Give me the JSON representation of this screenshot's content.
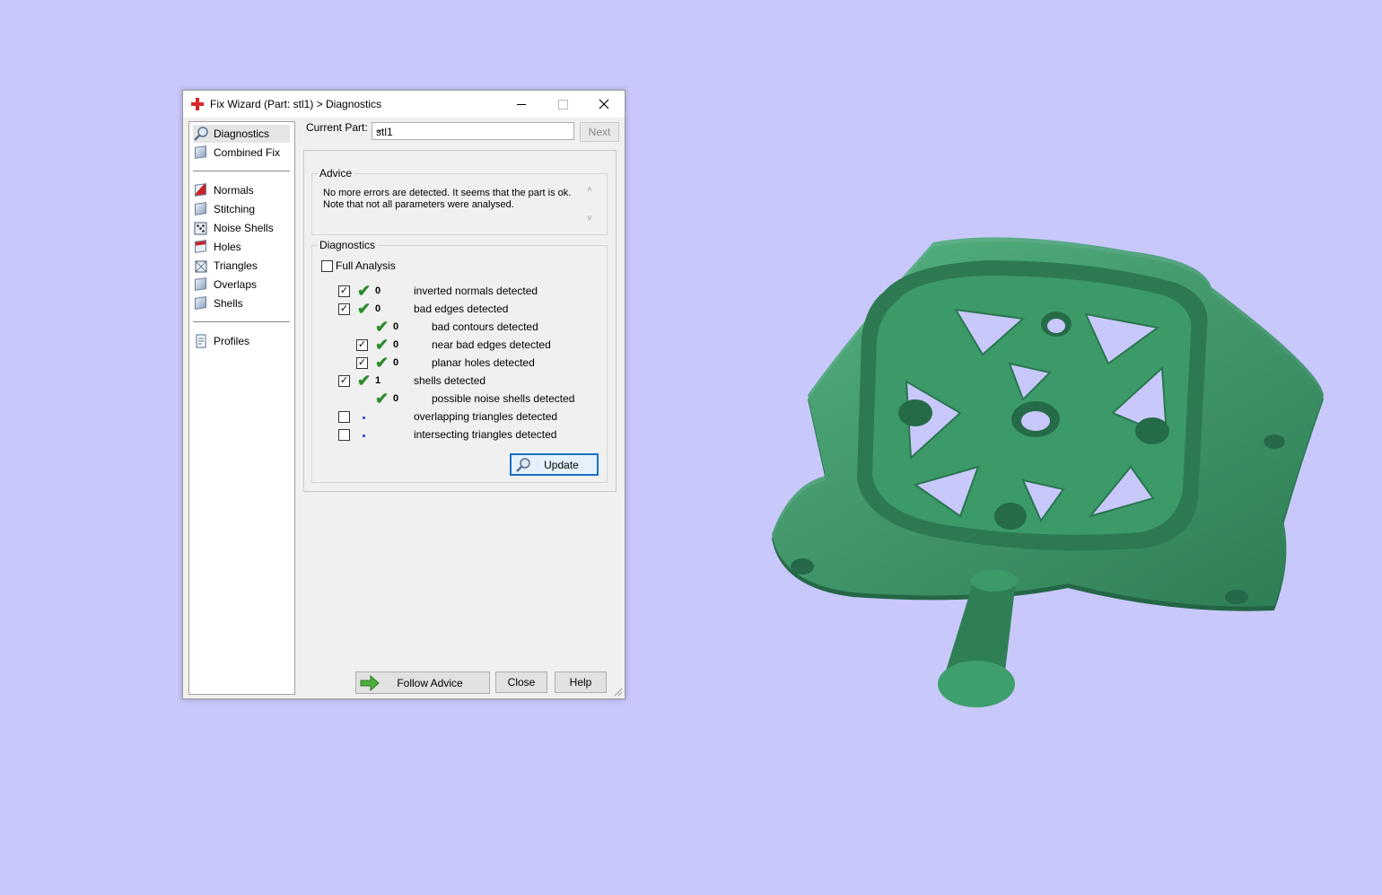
{
  "window": {
    "title": "Fix Wizard (Part: stl1) > Diagnostics",
    "minimize_icon": "minimize-icon",
    "maximize_icon": "maximize-icon",
    "close_icon": "close-icon"
  },
  "nav": {
    "items": [
      {
        "label": "Diagnostics",
        "icon": "magnifier-icon",
        "selected": true
      },
      {
        "label": "Combined Fix",
        "icon": "cube-icon"
      },
      {
        "label": "Normals",
        "icon": "cube-red-icon"
      },
      {
        "label": "Stitching",
        "icon": "cube-icon"
      },
      {
        "label": "Noise Shells",
        "icon": "dice-icon"
      },
      {
        "label": "Holes",
        "icon": "cube-red-icon"
      },
      {
        "label": "Triangles",
        "icon": "cube-icon"
      },
      {
        "label": "Overlaps",
        "icon": "cube-icon"
      },
      {
        "label": "Shells",
        "icon": "cube-icon"
      },
      {
        "label": "Profiles",
        "icon": "document-icon"
      }
    ]
  },
  "current_part": {
    "label": "Current Part:",
    "value": "stl1",
    "next_label": "Next"
  },
  "advice": {
    "title": "Advice",
    "line1": "No more errors are detected. It seems that the part is ok.",
    "line2": "Note that not all parameters were analysed."
  },
  "diagnostics": {
    "title": "Diagnostics",
    "full_analysis_label": "Full Analysis",
    "full_analysis_checked": false,
    "rows": [
      {
        "checkbox": true,
        "checked": true,
        "status": "ok",
        "count": "0",
        "text": "inverted normals detected",
        "indent": 0
      },
      {
        "checkbox": true,
        "checked": true,
        "status": "ok",
        "count": "0",
        "text": "bad edges detected",
        "indent": 0
      },
      {
        "checkbox": false,
        "checked": false,
        "status": "ok",
        "count": "0",
        "text": "bad contours detected",
        "indent": 1
      },
      {
        "checkbox": true,
        "checked": true,
        "status": "ok",
        "count": "0",
        "text": "near bad edges detected",
        "indent": 1
      },
      {
        "checkbox": true,
        "checked": true,
        "status": "ok",
        "count": "0",
        "text": "planar holes detected",
        "indent": 1
      },
      {
        "checkbox": true,
        "checked": true,
        "status": "ok",
        "count": "1",
        "text": "shells detected",
        "indent": 0
      },
      {
        "checkbox": false,
        "checked": false,
        "status": "ok",
        "count": "0",
        "text": "possible noise shells detected",
        "indent": 1
      },
      {
        "checkbox": true,
        "checked": false,
        "status": "unknown",
        "count": "",
        "text": "overlapping triangles detected",
        "indent": 0
      },
      {
        "checkbox": true,
        "checked": false,
        "status": "unknown",
        "count": "",
        "text": "intersecting triangles detected",
        "indent": 0
      }
    ],
    "update_label": "Update"
  },
  "footer": {
    "follow_advice_label": "Follow Advice",
    "close_label": "Close",
    "help_label": "Help"
  },
  "colors": {
    "background": "#c8c8fb",
    "model": "#3f9a6a",
    "check": "#2e8b2e"
  }
}
